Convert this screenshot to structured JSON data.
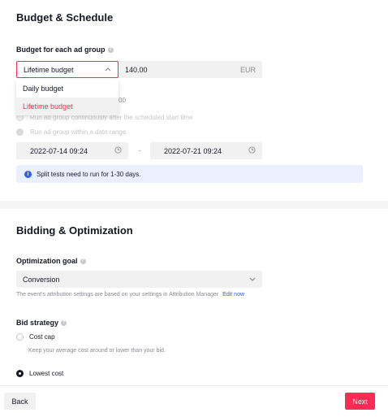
{
  "budget_schedule": {
    "title": "Budget & Schedule",
    "budget_label": "Budget for each ad group",
    "budget_type_selected": "Lifetime budget",
    "budget_amount": "140.00",
    "currency": "EUR",
    "dropdown_options": [
      "Daily budget",
      "Lifetime budget"
    ],
    "hidden_fragment": "00",
    "schedule_option_1": "Run ad group continuously after the scheduled start time",
    "schedule_option_2": "Run ad group within a date range",
    "start_date": "2022-07-14 09:24",
    "separator": "-",
    "end_date": "2022-07-21 09:24",
    "info_text": "Split tests need to run for 1-30 days."
  },
  "bidding": {
    "title": "Bidding & Optimization",
    "goal_label": "Optimization goal",
    "goal_value": "Conversion",
    "attribution_note": "The event's attribution settings are based on your settings in Attribution Manager",
    "edit_link": "Edit now",
    "bid_strategy_label": "Bid strategy",
    "cost_cap_label": "Cost cap",
    "cost_cap_desc": "Keep your average cost around or lower than your bid.",
    "lowest_cost_label": "Lowest cost"
  },
  "footer": {
    "back_label": "Back",
    "next_label": "Next"
  },
  "colors": {
    "accent": "#fe2c55",
    "info_bg": "#eaf0ff",
    "info_icon": "#3360e8"
  }
}
